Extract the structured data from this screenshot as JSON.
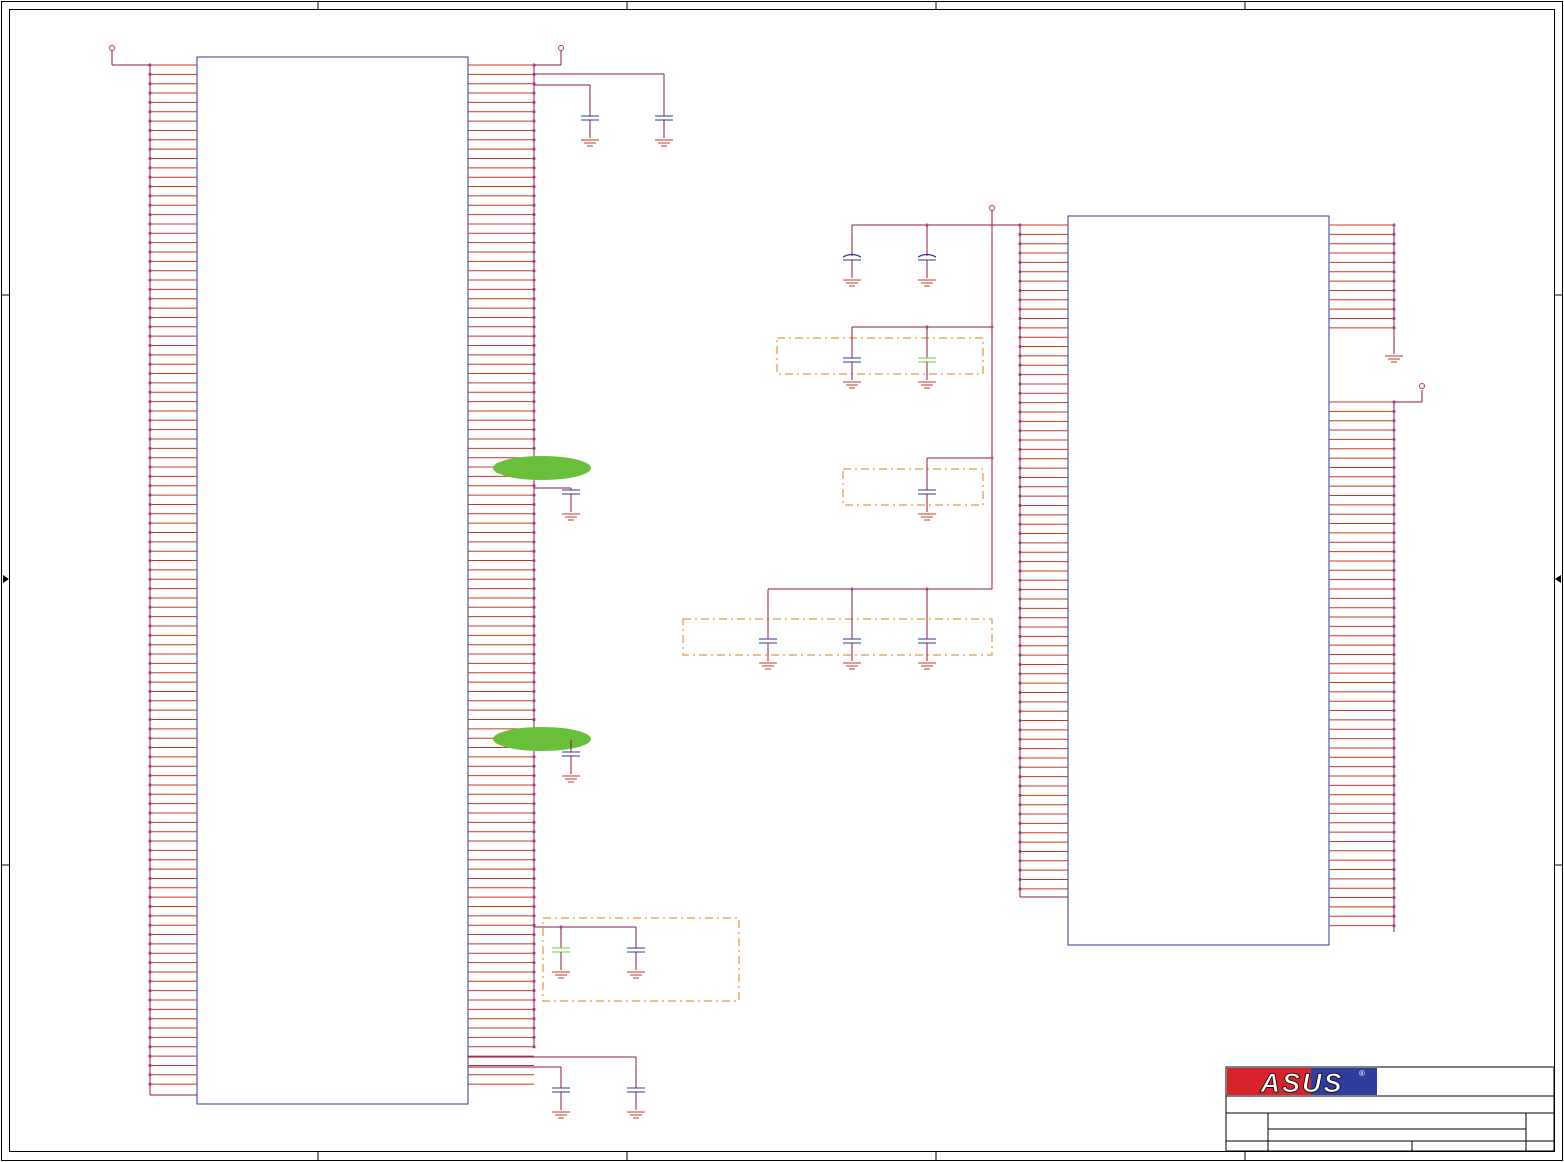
{
  "sheet": {
    "background": "#ffffff",
    "frame_color": "#000000"
  },
  "colors": {
    "wire": "#8b1a4a",
    "pin": "#c0392b",
    "junction": "#b84fb5",
    "component_outline": "#2a3a9c",
    "capacitor": "#2a3a9c",
    "capacitor_alt": "#7ac142",
    "ground": "#c0392b",
    "power_flag": "#d6283a",
    "dashed_group": "#e07b1a",
    "highlight": "#6abf3a"
  },
  "title_block": {
    "logo_text": "ASUS",
    "logo_mark": "®",
    "logo_red": "#d8232a",
    "logo_blue": "#2f3e9e"
  },
  "components": {
    "left_ic": {
      "pin_rows": 110
    },
    "right_ic": {
      "left_pin_rows": 72,
      "right_upper_rows": 13,
      "right_lower_rows": 57
    }
  }
}
